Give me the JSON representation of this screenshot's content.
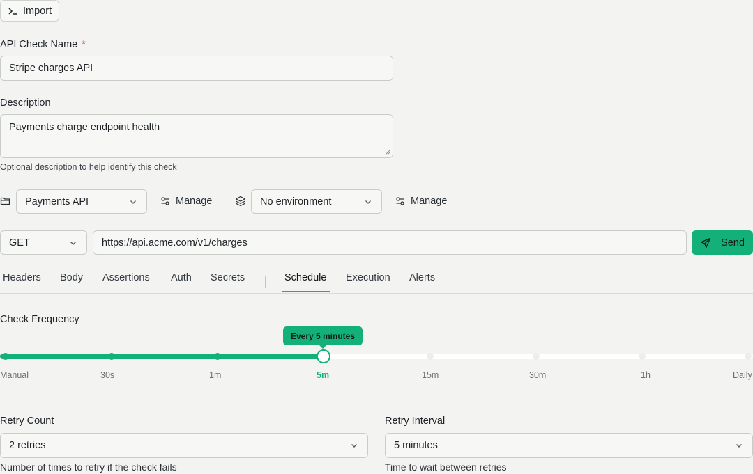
{
  "toolbar": {
    "import_label": "Import"
  },
  "form": {
    "name_label": "API Check Name",
    "required_mark": "*",
    "name_value": "Stripe charges API",
    "description_label": "Description",
    "description_value": "Payments charge endpoint health",
    "description_help": "Optional description to help identify this check"
  },
  "context": {
    "group_value": "Payments API",
    "group_manage": "Manage",
    "env_value": "No environment",
    "env_manage": "Manage"
  },
  "request": {
    "method": "GET",
    "url": "https://api.acme.com/v1/charges",
    "send_label": "Send"
  },
  "tabs": {
    "left": [
      "Headers",
      "Body",
      "Assertions",
      "Auth",
      "Secrets"
    ],
    "right": [
      "Schedule",
      "Execution",
      "Alerts"
    ],
    "active": "Schedule"
  },
  "frequency": {
    "label": "Check Frequency",
    "tooltip": "Every 5 minutes",
    "ticks": [
      "Manual",
      "30s",
      "1m",
      "5m",
      "15m",
      "30m",
      "1h",
      "Daily"
    ],
    "selected_index": 3,
    "accent": "#14b07a"
  },
  "retry": {
    "count_label": "Retry Count",
    "count_value": "2 retries",
    "count_help": "Number of times to retry if the check fails",
    "interval_label": "Retry Interval",
    "interval_value": "5 minutes",
    "interval_help": "Time to wait between retries"
  }
}
